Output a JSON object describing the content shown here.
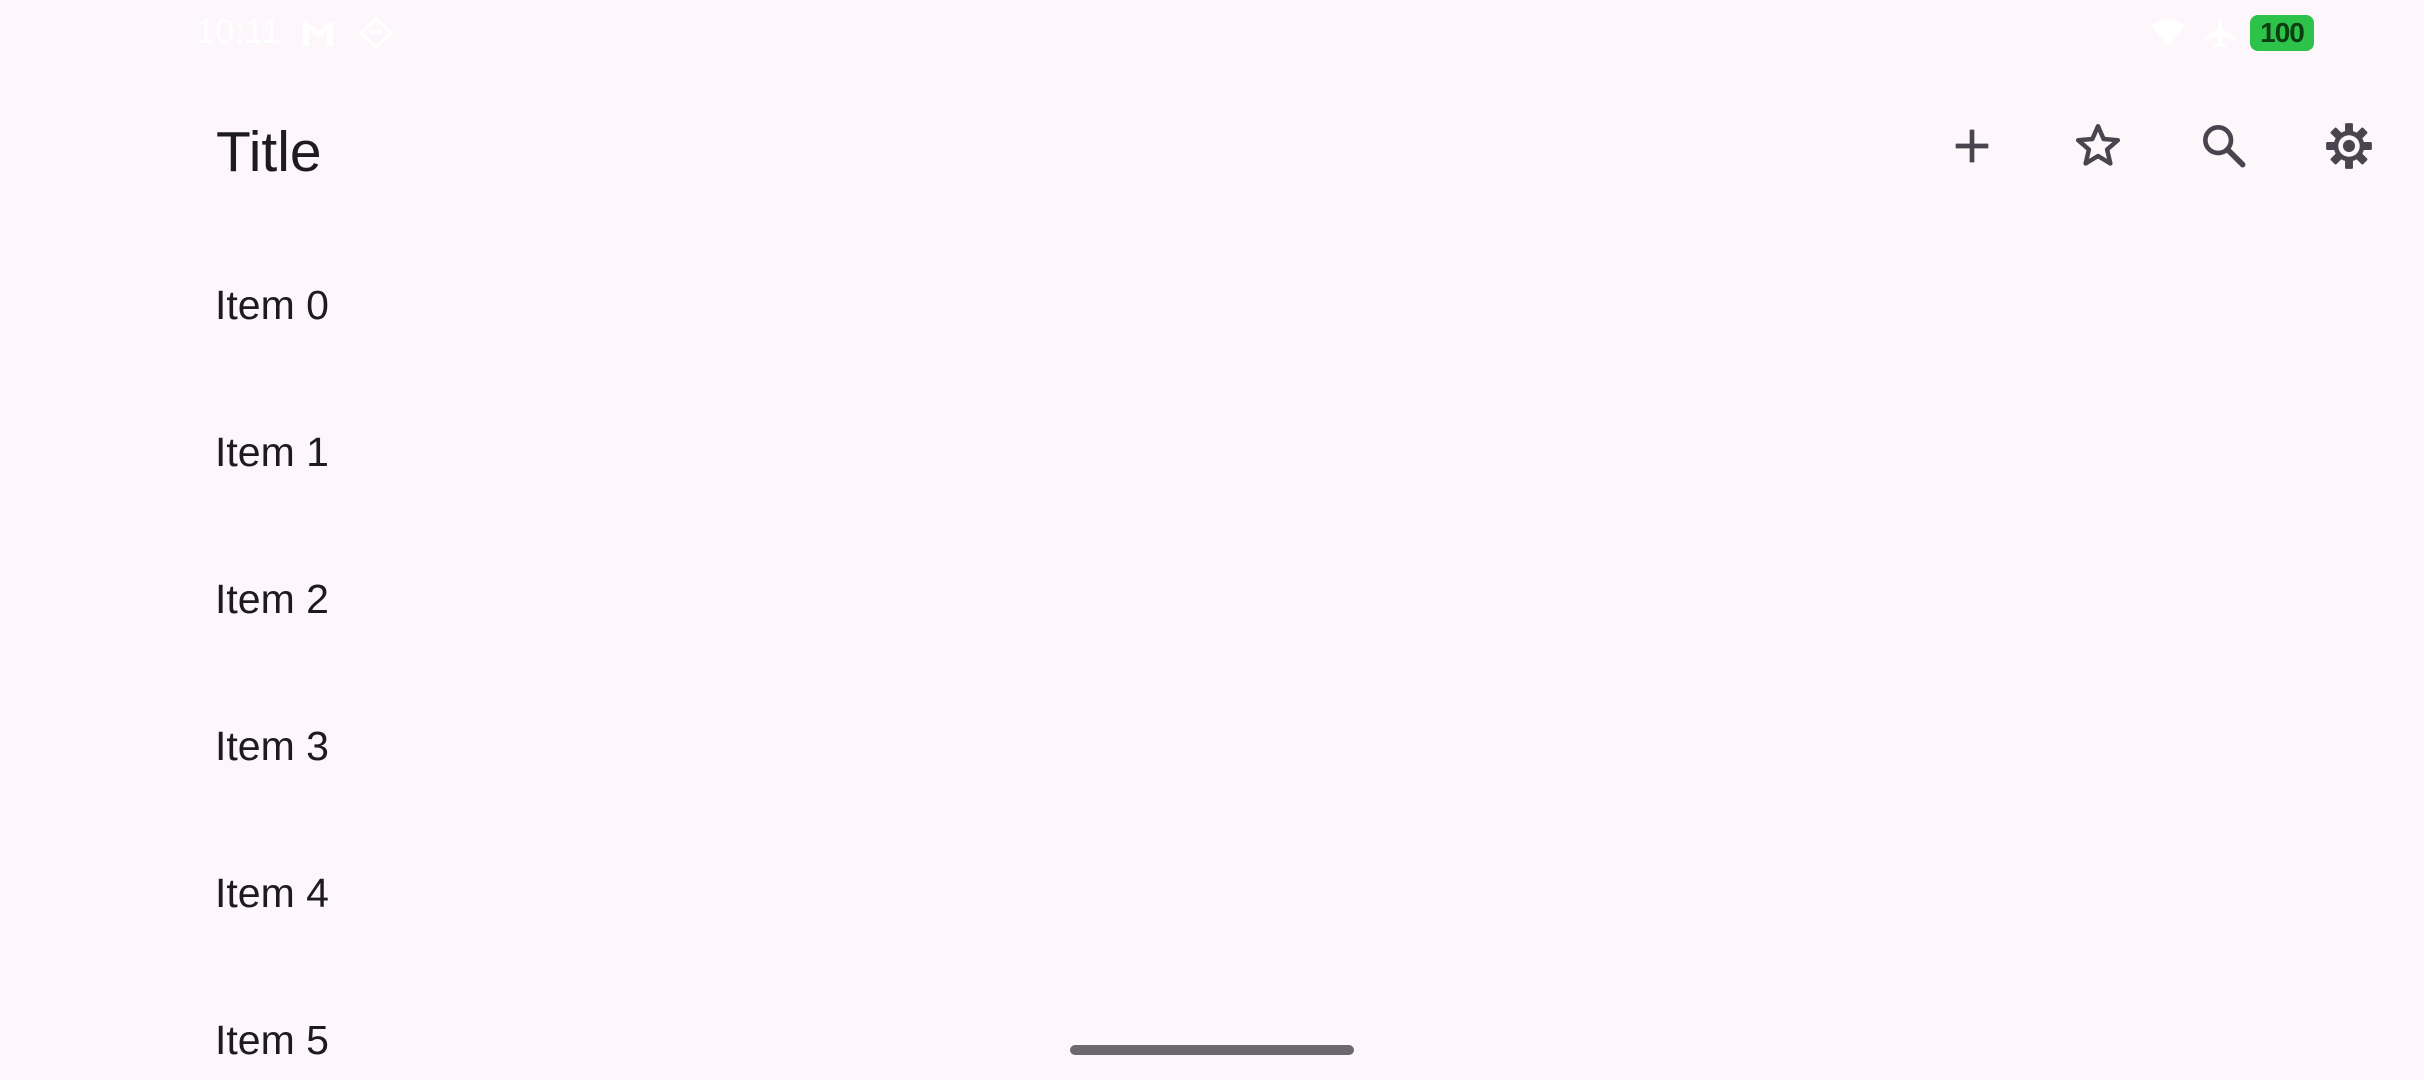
{
  "status_bar": {
    "time": "10:11",
    "battery_level": "100",
    "icons": [
      "gmail-icon",
      "location-diamond-icon",
      "wifi-icon",
      "airplane-mode-icon"
    ]
  },
  "app_bar": {
    "title": "Title",
    "actions": [
      {
        "icon": "add-icon"
      },
      {
        "icon": "star-outline-icon"
      },
      {
        "icon": "search-icon"
      },
      {
        "icon": "settings-icon"
      }
    ]
  },
  "list": {
    "items": [
      {
        "label": "Item 0"
      },
      {
        "label": "Item 1"
      },
      {
        "label": "Item 2"
      },
      {
        "label": "Item 3"
      },
      {
        "label": "Item 4"
      },
      {
        "label": "Item 5"
      }
    ]
  },
  "colors": {
    "background": "#fdf7fc",
    "text_primary": "#1d1b20",
    "icon": "#49454f",
    "battery": "#2dc24a",
    "gesture_handle": "#6b6870"
  }
}
